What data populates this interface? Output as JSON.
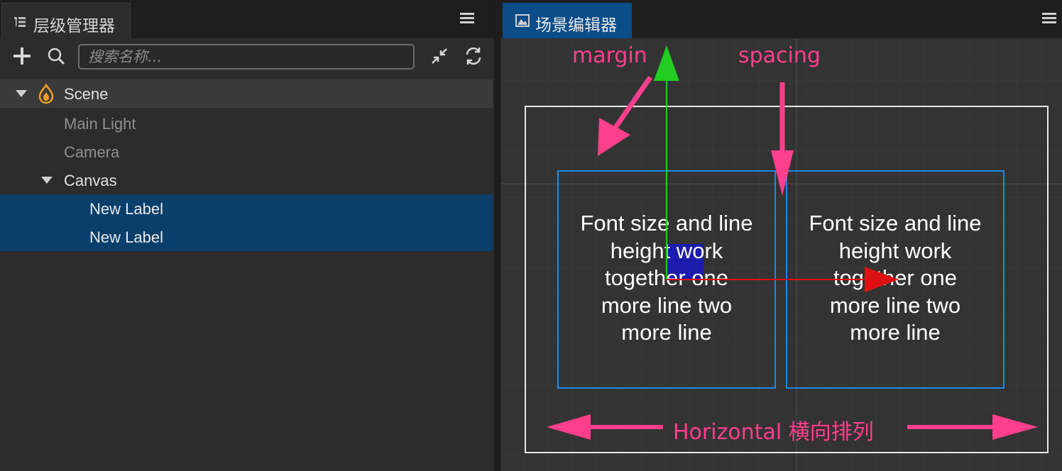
{
  "hierarchy": {
    "tab_title": "层级管理器",
    "search_placeholder": "搜索名称...",
    "nodes": {
      "scene": "Scene",
      "main_light": "Main Light",
      "camera": "Camera",
      "canvas": "Canvas",
      "label_1": "New Label",
      "label_2": "New Label"
    }
  },
  "scene_editor": {
    "tab_title": "场景编辑器",
    "annotations": {
      "margin": "margin",
      "spacing": "spacing",
      "horizontal": "Horizontal 横向排列"
    },
    "label_text": "Font size and line height work together one more line two more line",
    "label_lines": [
      "Font size and line",
      "height work",
      "together one",
      "more line two",
      "more line"
    ]
  },
  "colors": {
    "accent_selection": "#093f6b",
    "annotation": "#ff3f8c",
    "gizmo_y": "#22cc22",
    "gizmo_x": "#dd1111",
    "label_border": "#1e88e5"
  }
}
